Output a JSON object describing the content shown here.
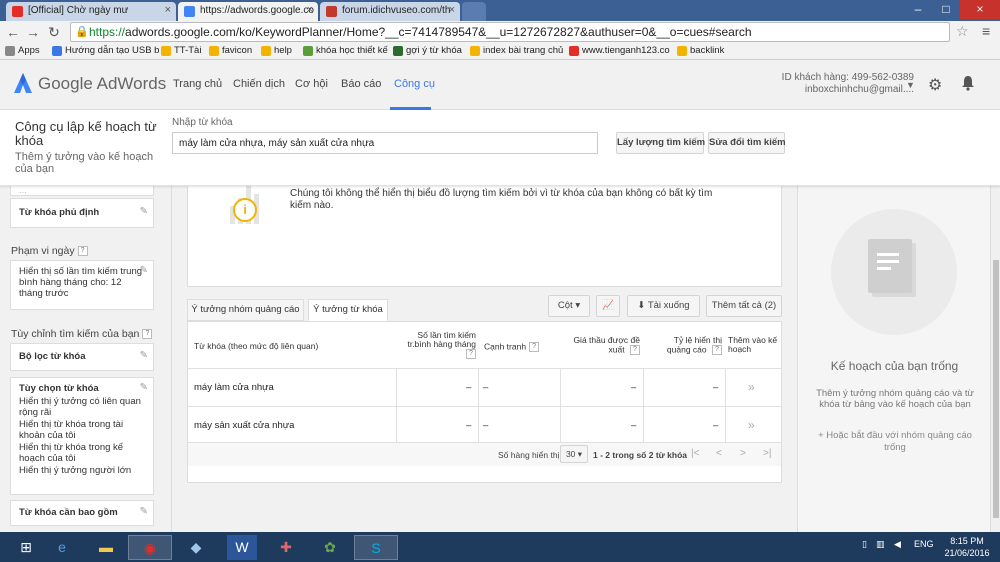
{
  "browser": {
    "tabs": [
      {
        "label": "[Official] Chờ ngày mư",
        "favicon_color": "#e52d27"
      },
      {
        "label": "https://adwords.google.co",
        "favicon_color": "#4285f4"
      },
      {
        "label": "forum.idichvuseo.com/th",
        "favicon_color": "#c0392b"
      }
    ],
    "url_https": "https://",
    "url_rest": "adwords.google.com/ko/KeywordPlanner/Home?__c=7414789547&__u=1272672827&authuser=0&__o=cues#search",
    "bookmarks": [
      {
        "label": "Apps",
        "color": "#888888"
      },
      {
        "label": "Hướng dẫn tạo USB b",
        "color": "#3b78e7"
      },
      {
        "label": "TT-Tài",
        "color": "#f2b400"
      },
      {
        "label": "favicon",
        "color": "#f2b400"
      },
      {
        "label": "help",
        "color": "#f2b400"
      },
      {
        "label": "khóa học thiết kế",
        "color": "#5a9e3a"
      },
      {
        "label": "gợi ý từ khóa",
        "color": "#2d6a2d"
      },
      {
        "label": "index bài trang chủ",
        "color": "#f2b400"
      },
      {
        "label": "www.tienganh123.co",
        "color": "#e52d27"
      },
      {
        "label": "backlink",
        "color": "#f2b400"
      }
    ]
  },
  "header": {
    "logo_text": "Google AdWords",
    "nav": [
      "Trang chủ",
      "Chiến dịch",
      "Cơ hội",
      "Báo cáo",
      "Công cụ"
    ],
    "account_id": "ID khách hàng: 499-562-0389",
    "account_email": "inboxchinhchu@gmail....",
    "accent": "#3b78e7"
  },
  "planner": {
    "title": "Công cụ lập kế hoạch từ khóa",
    "subtitle": "Thêm ý tưởng vào kế hoạch của bạn",
    "input_label": "Nhập từ khóa",
    "input_value": "máy làm cửa nhựa, máy sản xuất cửa nhựa",
    "btn_get_volume": "Lấy lượng tìm kiếm",
    "btn_modify": "Sửa đổi tìm kiếm"
  },
  "sidebar": {
    "card_top": "...",
    "negative_keywords": "Từ khóa phủ định",
    "date_range_heading": "Phạm vi ngày",
    "date_range_text": "Hiển thị số lần tìm kiếm trung bình hàng tháng cho: 12 tháng trước",
    "customize_heading": "Tùy chỉnh tìm kiếm của bạn",
    "keyword_filter": "Bộ lọc từ khóa",
    "keyword_options_title": "Tùy chọn từ khóa",
    "keyword_options": [
      "Hiển thị ý tưởng có liên quan rộng rãi",
      "Hiển thị từ khóa trong tài khoản của tôi",
      "Hiển thị từ khóa trong kế hoạch của tôi",
      "Hiển thị ý tưởng người lớn"
    ],
    "keywords_to_include": "Từ khóa cần bao gồm",
    "help_mark": "?"
  },
  "main": {
    "chart_message": "Chúng tôi không thể hiển thị biểu đồ lượng tìm kiếm bởi vì từ khóa của bạn không có bất kỳ tìm kiếm nào.",
    "info_glyph": "i",
    "tabs": [
      "Ý tưởng nhóm quảng cáo",
      "Ý tưởng từ khóa"
    ],
    "btn_columns": "Cột ▾",
    "btn_download": "Tải xuống",
    "btn_add_all": "Thêm tất cả (2)",
    "columns": {
      "keyword": "Từ khóa (theo mức độ liên quan)",
      "searches": "Số lần tìm kiếm tr.bình hàng tháng",
      "competition": "Cạnh tranh",
      "bid": "Giá thầu được đề xuất",
      "share": "Tỷ lệ hiển thị quảng cáo",
      "add": "Thêm vào kế hoạch"
    },
    "rows": [
      {
        "keyword": "máy làm cửa nhựa",
        "searches": "–",
        "competition": "–",
        "bid": "–",
        "share": "–",
        "add": "»"
      },
      {
        "keyword": "máy sản xuất cửa nhựa",
        "searches": "–",
        "competition": "–",
        "bid": "–",
        "share": "–",
        "add": "»"
      }
    ],
    "pager_label": "Số hàng hiển thị",
    "pager_size": "30",
    "pager_range": "1 - 2 trong số 2 từ khóa",
    "pager_buttons": [
      "|<",
      "<",
      ">",
      ">|"
    ]
  },
  "right_panel": {
    "title": "Kế hoạch của bạn trống",
    "subtitle": "Thêm ý tưởng nhóm quảng cáo và từ khóa từ bảng vào kế hoạch của bạn",
    "link": "+ Hoặc bắt đầu với nhóm quảng cáo trống"
  },
  "taskbar": {
    "lang": "ENG",
    "time": "8:15 PM",
    "date": "21/06/2016"
  }
}
